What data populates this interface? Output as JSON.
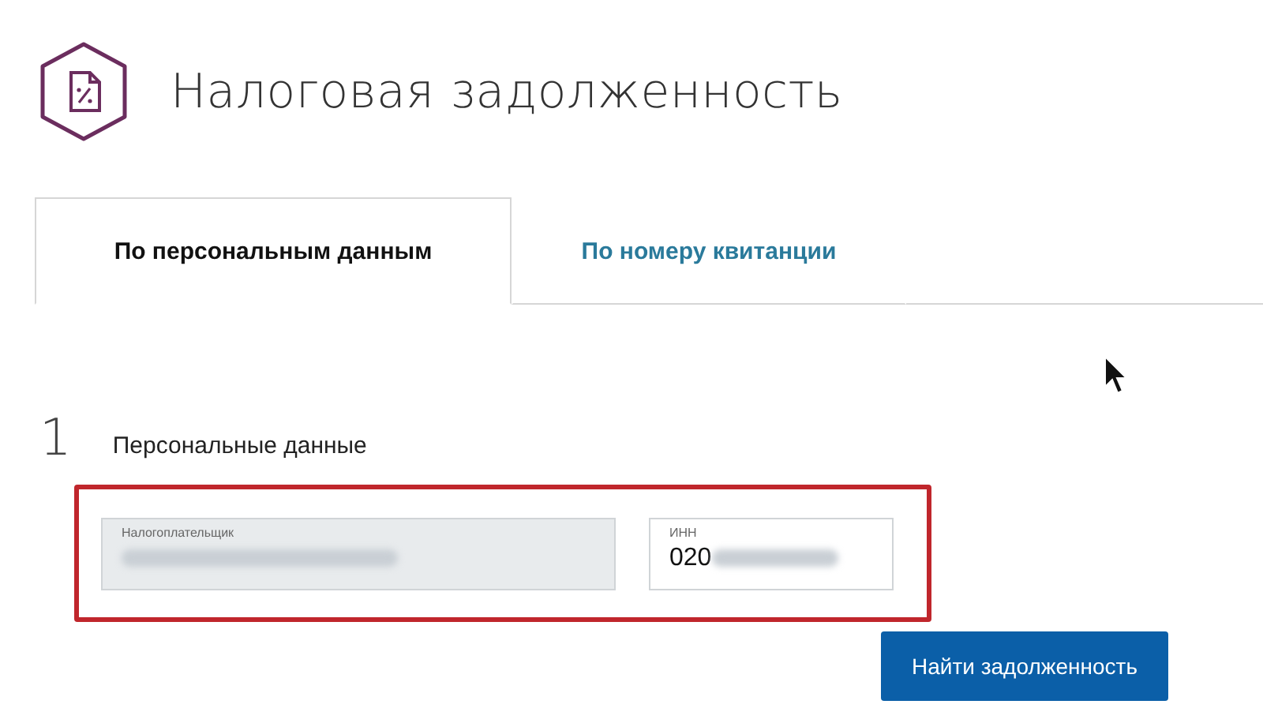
{
  "header": {
    "title": "Налоговая задолженность"
  },
  "tabs": [
    {
      "label": "По персональным данным",
      "selected": true
    },
    {
      "label": "По номеру квитанции",
      "selected": false
    }
  ],
  "step": {
    "number": "1",
    "title": "Персональные данные",
    "highlighted": true
  },
  "fields": [
    {
      "label": "Налогоплательщик",
      "redacted": true,
      "disabled": true
    },
    {
      "label": "ИНН",
      "value": "020",
      "redacted": true,
      "disabled": false
    }
  ],
  "button": {
    "label": "Найти задолженность"
  }
}
